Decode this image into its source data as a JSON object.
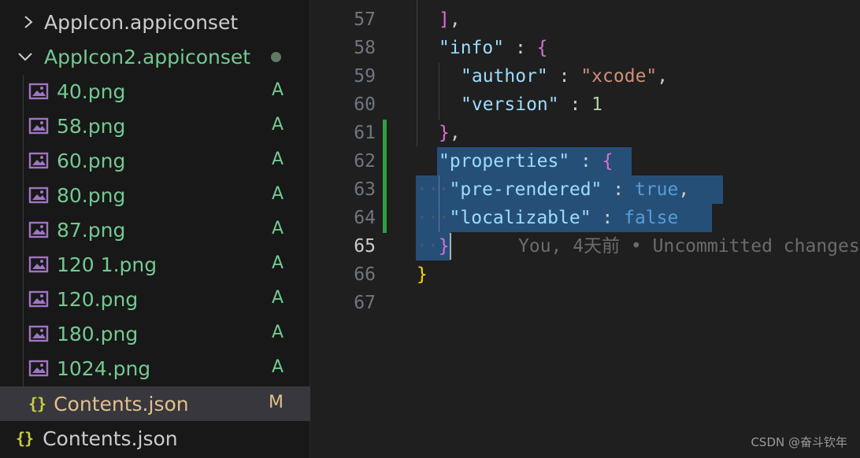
{
  "explorer": {
    "folder_closed": {
      "label": "AppIcon.appiconset",
      "icon": "chevron-right-icon"
    },
    "folder_open": {
      "label": "AppIcon2.appiconset",
      "icon": "chevron-down-icon",
      "modified_dot_color": "#5f7a63"
    },
    "files": [
      {
        "label": "40.png",
        "status": "A",
        "icon": "image-icon"
      },
      {
        "label": "58.png",
        "status": "A",
        "icon": "image-icon"
      },
      {
        "label": "60.png",
        "status": "A",
        "icon": "image-icon"
      },
      {
        "label": "80.png",
        "status": "A",
        "icon": "image-icon"
      },
      {
        "label": "87.png",
        "status": "A",
        "icon": "image-icon"
      },
      {
        "label": "120 1.png",
        "status": "A",
        "icon": "image-icon"
      },
      {
        "label": "120.png",
        "status": "A",
        "icon": "image-icon"
      },
      {
        "label": "180.png",
        "status": "A",
        "icon": "image-icon"
      },
      {
        "label": "1024.png",
        "status": "A",
        "icon": "image-icon"
      },
      {
        "label": "Contents.json",
        "status": "M",
        "icon": "json-braces-icon"
      }
    ],
    "root_file": {
      "label": "Contents.json",
      "icon": "json-braces-icon"
    },
    "json_icon_glyph": "{}"
  },
  "editor": {
    "line_numbers": [
      "57",
      "58",
      "59",
      "60",
      "61",
      "62",
      "63",
      "64",
      "65",
      "66",
      "67"
    ],
    "active_line": "65",
    "lines": {
      "l57_bracket": "]",
      "l57_comma": ",",
      "l58_key": "\"info\"",
      "l58_colon": " : ",
      "l58_brace": "{",
      "l59_key": "\"author\"",
      "l59_colon": " : ",
      "l59_val": "\"xcode\"",
      "l59_comma": ",",
      "l60_key": "\"version\"",
      "l60_colon": " : ",
      "l60_val": "1",
      "l61_brace": "}",
      "l61_comma": ",",
      "l62_key": "\"properties\"",
      "l62_colon": " : ",
      "l62_brace": "{",
      "l63_ws": "···",
      "l63_key": "\"pre-rendered\"",
      "l63_colon": " : ",
      "l63_val": "true",
      "l63_comma": ",",
      "l64_ws": "···",
      "l64_key": "\"localizable\"",
      "l64_colon": " : ",
      "l64_val": "false",
      "l65_ws": "··",
      "l65_brace": "}",
      "l66_brace": "}"
    },
    "blame": "You, 4天前 • Uncommitted changes"
  },
  "watermark": "CSDN @奋斗钦年",
  "colors": {
    "added": "#73c991",
    "modified": "#e2c08d",
    "selection": "#264f78",
    "gutter_added": "#2ea043"
  }
}
